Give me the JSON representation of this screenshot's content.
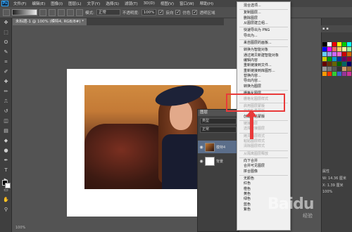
{
  "menubar": {
    "app_icon": "Ps",
    "items": [
      "文件(F)",
      "编辑(E)",
      "图像(I)",
      "图层(L)",
      "文字(Y)",
      "选择(S)",
      "滤镜(T)",
      "3D(D)",
      "视图(V)",
      "窗口(W)",
      "帮助(H)"
    ]
  },
  "optionsbar": {
    "mode_label": "模式:",
    "mode_value": "正常",
    "opacity_label": "不透明度:",
    "opacity_value": "100%",
    "reverse_label": "反向",
    "dither_label": "仿色",
    "transparency_label": "透明区域"
  },
  "document": {
    "tab_title": "未标题-1 @ 100% (模特4, RGB/8#) *"
  },
  "layers_panel": {
    "tab_label": "图层",
    "filter_placeholder": "类型",
    "blend_mode": "正常",
    "layers": [
      {
        "name": "模特4",
        "selected": true
      },
      {
        "name": "背景",
        "selected": false
      }
    ]
  },
  "context_menu": {
    "items": [
      {
        "label": "混合选项...",
        "enabled": true
      },
      {
        "sep": true
      },
      {
        "label": "复制图层...",
        "enabled": true
      },
      {
        "label": "删除图层",
        "enabled": true
      },
      {
        "label": "从图层建立组...",
        "enabled": true
      },
      {
        "sep": true
      },
      {
        "label": "快速导出为 PNG",
        "enabled": true
      },
      {
        "label": "导出为...",
        "enabled": true
      },
      {
        "sep": true
      },
      {
        "label": "来自图层的画板...",
        "enabled": true
      },
      {
        "sep": true
      },
      {
        "label": "转换为智能对象",
        "enabled": true
      },
      {
        "label": "通过拷贝新建智能对象",
        "enabled": true
      },
      {
        "label": "编辑内容",
        "enabled": true
      },
      {
        "label": "重新链接到文件...",
        "enabled": true
      },
      {
        "label": "重新链接到库图形...",
        "enabled": true
      },
      {
        "label": "替换内容...",
        "enabled": true
      },
      {
        "label": "导出内容...",
        "enabled": true
      },
      {
        "label": "转换为图层",
        "enabled": true
      },
      {
        "sep": true
      },
      {
        "label": "栅格化图层",
        "enabled": true
      },
      {
        "label": "栅格化图层样式",
        "enabled": false
      },
      {
        "sep": true
      },
      {
        "label": "启用图层蒙版",
        "enabled": false
      },
      {
        "label": "启用矢量蒙版",
        "enabled": false
      },
      {
        "label": "创建剪贴蒙版",
        "enabled": true
      },
      {
        "sep": true
      },
      {
        "label": "链接图层",
        "enabled": false
      },
      {
        "label": "选择链接图层",
        "enabled": false
      },
      {
        "sep": true
      },
      {
        "label": "拷贝图层样式",
        "enabled": false
      },
      {
        "label": "粘贴图层样式",
        "enabled": false
      },
      {
        "label": "清除图层样式",
        "enabled": false
      },
      {
        "sep": true
      },
      {
        "label": "从隔离图层释放",
        "enabled": false
      },
      {
        "sep": true
      },
      {
        "label": "向下合并",
        "enabled": true
      },
      {
        "label": "合并可见图层",
        "enabled": true
      },
      {
        "label": "拼合图像",
        "enabled": true
      },
      {
        "sep": true
      },
      {
        "label": "无颜色",
        "enabled": true
      },
      {
        "label": "红色",
        "enabled": true
      },
      {
        "label": "橙色",
        "enabled": true
      },
      {
        "label": "黄色",
        "enabled": true
      },
      {
        "label": "绿色",
        "enabled": true
      },
      {
        "label": "蓝色",
        "enabled": true
      },
      {
        "label": "紫色",
        "enabled": true
      }
    ]
  },
  "right_panel": {
    "props_tab": "属性",
    "w_label": "W:",
    "w_value": "14.36 厘米",
    "x_label": "X:",
    "x_value": "1.39 厘米",
    "percent": "100%"
  },
  "status": {
    "zoom": "100%"
  },
  "watermark": {
    "text": "Baidu",
    "sub": "经验"
  },
  "colors": {
    "highlight_red": "#e93a3a",
    "ps_blue": "#31a8ff"
  }
}
